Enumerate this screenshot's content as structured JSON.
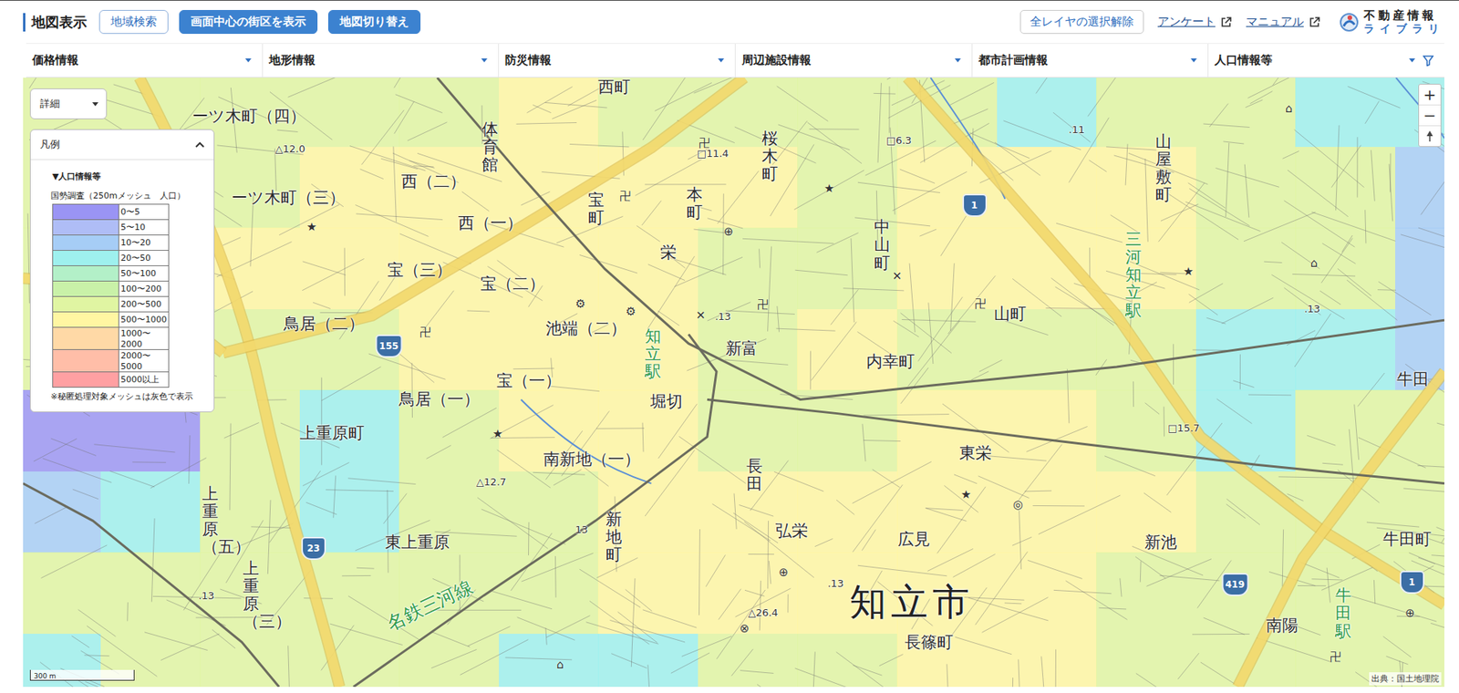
{
  "header": {
    "title": "地図表示",
    "buttons": [
      {
        "label": "地域検索",
        "kind": "outline"
      },
      {
        "label": "画面中心の街区を表示",
        "kind": "filled"
      },
      {
        "label": "地図切り替え",
        "kind": "filled"
      }
    ],
    "clear_button": "全レイヤの選択解除",
    "links": [
      "アンケート",
      "マニュアル"
    ],
    "logo": {
      "top": "不動産情報",
      "bottom": "ライブラリ"
    }
  },
  "menus": [
    "価格情報",
    "地形情報",
    "防災情報",
    "周辺施設情報",
    "都市計画情報",
    "人口情報等"
  ],
  "map": {
    "detail_button": "詳細",
    "legend": {
      "title": "凡例",
      "expanded": true,
      "section": "▼人口情報等",
      "subtitle": "国勢調査（250mメッシュ　人口）",
      "items": [
        {
          "label": "0〜5",
          "color": "#9a94f4"
        },
        {
          "label": "5〜10",
          "color": "#afbdf6"
        },
        {
          "label": "10〜20",
          "color": "#a6cdf6"
        },
        {
          "label": "20〜50",
          "color": "#9ef0ee"
        },
        {
          "label": "50〜100",
          "color": "#b3f0c8"
        },
        {
          "label": "100〜200",
          "color": "#c9f1a8"
        },
        {
          "label": "200〜500",
          "color": "#e0f5a2"
        },
        {
          "label": "500〜1000",
          "color": "#fff6a2"
        },
        {
          "label": "1000〜2000",
          "color": "#ffd9a6"
        },
        {
          "label": "2000〜5000",
          "color": "#ffbea8"
        },
        {
          "label": "5000以上",
          "color": "#ffa0a2"
        }
      ],
      "note": "※秘匿処理対象メッシュは灰色で表示"
    },
    "mesh": {
      "rows": [
        [
          6,
          6,
          6,
          6,
          6,
          7,
          6,
          6,
          6,
          6,
          3,
          6,
          6,
          3,
          3
        ],
        [
          6,
          6,
          6,
          7,
          7,
          7,
          7,
          7,
          6,
          7,
          7,
          7,
          6,
          6,
          2
        ],
        [
          6,
          6,
          7,
          7,
          7,
          7,
          7,
          6,
          6,
          7,
          7,
          7,
          6,
          6,
          2
        ],
        [
          6,
          6,
          6,
          6,
          7,
          7,
          7,
          6,
          7,
          6,
          6,
          6,
          3,
          3,
          2
        ],
        [
          0,
          0,
          6,
          3,
          6,
          7,
          7,
          6,
          6,
          7,
          7,
          6,
          3,
          6,
          6
        ],
        [
          2,
          3,
          6,
          3,
          6,
          6,
          7,
          7,
          7,
          7,
          7,
          7,
          6,
          6,
          6
        ],
        [
          6,
          6,
          6,
          6,
          6,
          6,
          7,
          7,
          7,
          7,
          7,
          6,
          6,
          6,
          6
        ],
        [
          3,
          6,
          6,
          6,
          6,
          3,
          3,
          6,
          6,
          7,
          7,
          6,
          6,
          6,
          6
        ]
      ]
    },
    "labels": [
      {
        "text": "西町",
        "kind": "town"
      },
      {
        "text": "ーツ木町（四）",
        "kind": "town"
      },
      {
        "text": "△12.0",
        "kind": "spot"
      },
      {
        "text": "ーツ木町（三）",
        "kind": "town"
      },
      {
        "text": "西（二）",
        "kind": "town"
      },
      {
        "text": "西（一）",
        "kind": "town"
      },
      {
        "text": "体育館",
        "kind": "town-v"
      },
      {
        "text": "宝町",
        "kind": "town-v"
      },
      {
        "text": "本町",
        "kind": "town-v"
      },
      {
        "text": "桜木町",
        "kind": "town-v"
      },
      {
        "text": "□11.4",
        "kind": "spot"
      },
      {
        "text": "□6.3",
        "kind": "spot"
      },
      {
        "text": ".11",
        "kind": "spot"
      },
      {
        "text": "中山町",
        "kind": "town-v"
      },
      {
        "text": "山町",
        "kind": "town"
      },
      {
        "text": "山屋敷町",
        "kind": "town-v"
      },
      {
        "text": "三河知立駅",
        "kind": "station-v"
      },
      {
        "text": "宝（三）",
        "kind": "town"
      },
      {
        "text": "宝（二）",
        "kind": "town"
      },
      {
        "text": "栄",
        "kind": "town"
      },
      {
        "text": "鳥居（二）",
        "kind": "town"
      },
      {
        "text": "池端（二）",
        "kind": "town"
      },
      {
        "text": "知立駅",
        "kind": "station-v"
      },
      {
        "text": "堀切",
        "kind": "town"
      },
      {
        "text": "新富",
        "kind": "town"
      },
      {
        "text": ".13",
        "kind": "spot"
      },
      {
        "text": "内幸町",
        "kind": "town"
      },
      {
        "text": ".13",
        "kind": "spot"
      },
      {
        "text": "牛田",
        "kind": "town"
      },
      {
        "text": "鳥居（一）",
        "kind": "town"
      },
      {
        "text": "宝（一）",
        "kind": "town"
      },
      {
        "text": "□15.7",
        "kind": "spot"
      },
      {
        "text": "上重原町",
        "kind": "town"
      },
      {
        "text": "南新地（一）",
        "kind": "town"
      },
      {
        "text": "長田",
        "kind": "town-v"
      },
      {
        "text": "東栄",
        "kind": "town"
      },
      {
        "text": "△12.7",
        "kind": "spot"
      },
      {
        "text": "上重原（五）",
        "kind": "town-v"
      },
      {
        "text": "新地町",
        "kind": "town-v"
      },
      {
        "text": "弘栄",
        "kind": "town"
      },
      {
        "text": "広見",
        "kind": "town"
      },
      {
        "text": "新池",
        "kind": "town"
      },
      {
        "text": "牛田町",
        "kind": "town"
      },
      {
        "text": "13",
        "kind": "spot"
      },
      {
        "text": "東上重原",
        "kind": "town"
      },
      {
        "text": ".13",
        "kind": "spot"
      },
      {
        "text": "知立市",
        "kind": "city"
      },
      {
        "text": "上重原（三）",
        "kind": "town-v"
      },
      {
        "text": ".13",
        "kind": "spot"
      },
      {
        "text": "名鉄三河線",
        "kind": "rail"
      },
      {
        "text": "△26.4",
        "kind": "spot"
      },
      {
        "text": "長篠町",
        "kind": "town"
      },
      {
        "text": "南陽",
        "kind": "town"
      },
      {
        "text": "牛田駅",
        "kind": "station-v"
      }
    ],
    "symbols": [
      "卍",
      "卍",
      "卍",
      "卍",
      "卍",
      "卍",
      "⊕",
      "⊕",
      "⊕",
      "★",
      "★",
      "★",
      "★",
      "★",
      "✕",
      "✕",
      "◎",
      "⌂",
      "⌂",
      "⌂",
      "⚙",
      "⚙",
      "⊗"
    ],
    "shields": [
      "1",
      "155",
      "23",
      "419",
      "1"
    ],
    "zoom": [
      "+",
      "−"
    ],
    "scale": "300 m",
    "attribution": "出典：国土地理院"
  }
}
